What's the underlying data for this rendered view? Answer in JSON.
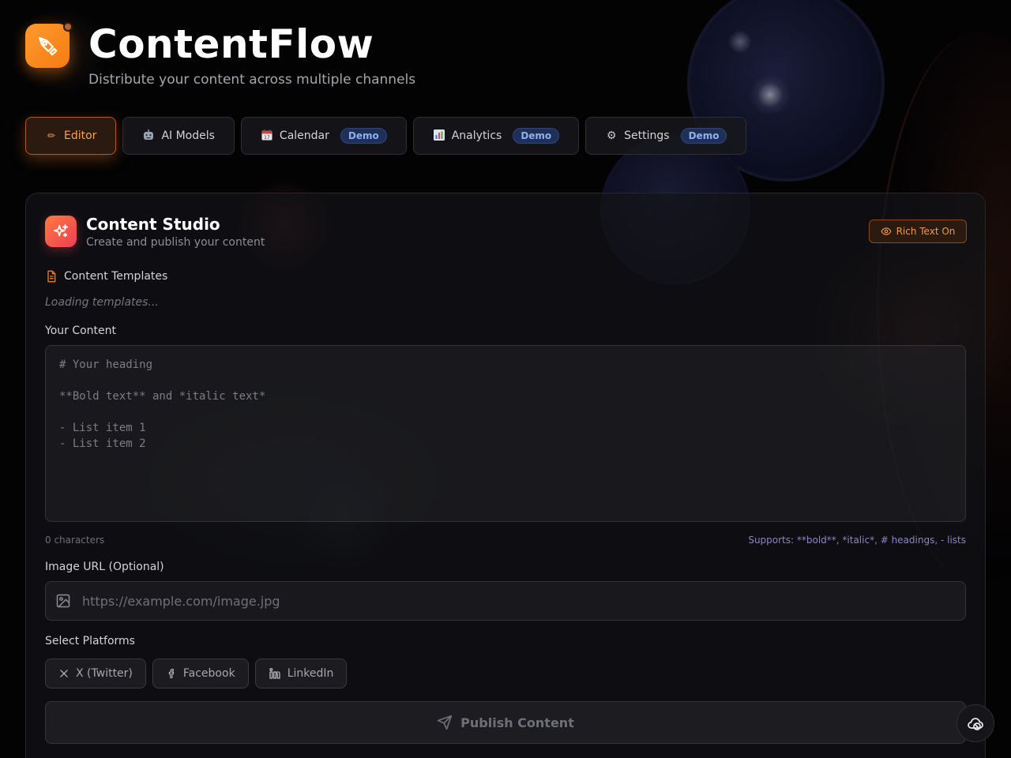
{
  "app": {
    "title": "ContentFlow",
    "subtitle": "Distribute your content across multiple channels"
  },
  "tabs": [
    {
      "label": "Editor",
      "icon": "pencil-icon",
      "active": true,
      "badge": ""
    },
    {
      "label": "AI Models",
      "icon": "robot-icon",
      "active": false,
      "badge": ""
    },
    {
      "label": "Calendar",
      "icon": "calendar-icon",
      "active": false,
      "badge": "Demo"
    },
    {
      "label": "Analytics",
      "icon": "bar-chart-icon",
      "active": false,
      "badge": "Demo"
    },
    {
      "label": "Settings",
      "icon": "gear-icon",
      "active": false,
      "badge": "Demo"
    }
  ],
  "studio": {
    "title": "Content Studio",
    "subtitle": "Create and publish your content",
    "rich_text_label": "Rich Text On",
    "templates_label": "Content Templates",
    "templates_status": "Loading templates...",
    "content_label": "Your Content",
    "content_placeholder": "# Your heading\n\n**Bold text** and *italic text*\n\n- List item 1\n- List item 2",
    "char_count": "0 characters",
    "supports_hint": "Supports: **bold**, *italic*, # headings, - lists",
    "image_label": "Image URL (Optional)",
    "image_placeholder": "https://example.com/image.jpg",
    "platforms_label": "Select Platforms",
    "platforms": [
      {
        "label": "X (Twitter)",
        "icon": "x-icon"
      },
      {
        "label": "Facebook",
        "icon": "facebook-icon"
      },
      {
        "label": "LinkedIn",
        "icon": "linkedin-icon"
      }
    ],
    "publish_label": "Publish Content"
  },
  "colors": {
    "accent": "#f57c12",
    "badge_bg": "#1e2f58",
    "badge_text": "#8fb0f0",
    "background": "#030304"
  }
}
